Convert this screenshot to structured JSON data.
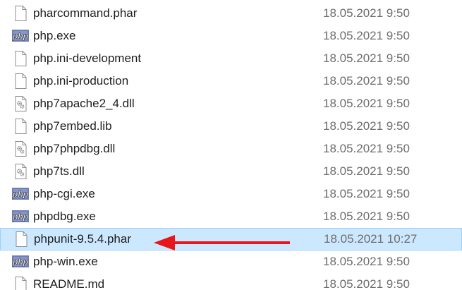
{
  "files": [
    {
      "name": "pharcommand.phar",
      "date": "18.05.2021 9:50",
      "icon": "file-icon",
      "selected": false
    },
    {
      "name": "php.exe",
      "date": "18.05.2021 9:50",
      "icon": "php-icon",
      "selected": false
    },
    {
      "name": "php.ini-development",
      "date": "18.05.2021 9:50",
      "icon": "file-icon",
      "selected": false
    },
    {
      "name": "php.ini-production",
      "date": "18.05.2021 9:50",
      "icon": "file-icon",
      "selected": false
    },
    {
      "name": "php7apache2_4.dll",
      "date": "18.05.2021 9:50",
      "icon": "dll-gear-icon",
      "selected": false
    },
    {
      "name": "php7embed.lib",
      "date": "18.05.2021 9:50",
      "icon": "file-icon",
      "selected": false
    },
    {
      "name": "php7phpdbg.dll",
      "date": "18.05.2021 9:50",
      "icon": "dll-gear-icon",
      "selected": false
    },
    {
      "name": "php7ts.dll",
      "date": "18.05.2021 9:50",
      "icon": "dll-gear-icon",
      "selected": false
    },
    {
      "name": "php-cgi.exe",
      "date": "18.05.2021 9:50",
      "icon": "php-icon",
      "selected": false
    },
    {
      "name": "phpdbg.exe",
      "date": "18.05.2021 9:50",
      "icon": "php-icon",
      "selected": false
    },
    {
      "name": "phpunit-9.5.4.phar",
      "date": "18.05.2021 10:27",
      "icon": "file-icon",
      "selected": true
    },
    {
      "name": "php-win.exe",
      "date": "18.05.2021 9:50",
      "icon": "php-icon",
      "selected": false
    },
    {
      "name": "README.md",
      "date": "18.05.2021 9:50",
      "icon": "file-icon",
      "selected": false
    }
  ],
  "colors": {
    "selection_background": "#cce8ff",
    "selection_border": "#99d1ff",
    "text": "#1e1e1e",
    "date_text": "#6d6d6d",
    "annotation_arrow": "#e8161b",
    "php_icon_background": "#6c7eb7"
  },
  "annotation": {
    "icon": "red-arrow-icon",
    "points_to": "phpunit-9.5.4.phar"
  }
}
